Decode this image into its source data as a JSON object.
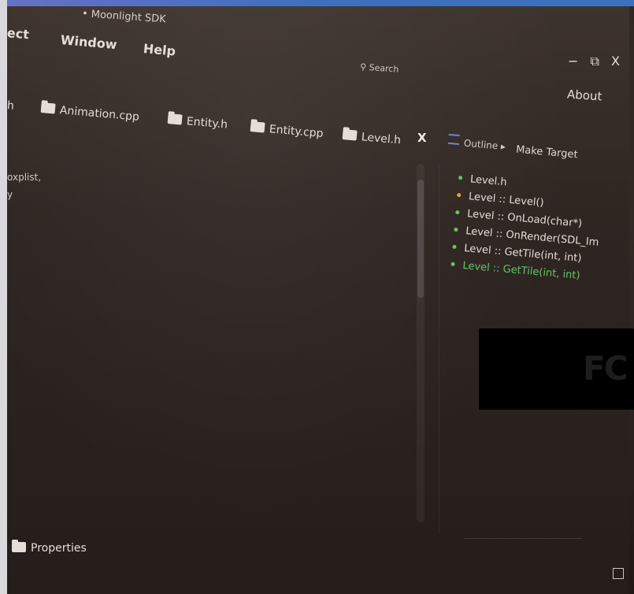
{
  "window": {
    "title": "• Moonlight SDK"
  },
  "menu": {
    "items": [
      {
        "label": "ect"
      },
      {
        "label": "Window"
      },
      {
        "label": "Help"
      }
    ]
  },
  "toolbar": {
    "search_label": "Search",
    "about_label": "About",
    "controls": {
      "minimize": "−",
      "restore": "⧉",
      "close": "X"
    }
  },
  "tabs": [
    {
      "label": "h"
    },
    {
      "label": "Animation.cpp"
    },
    {
      "label": "Entity.h"
    },
    {
      "label": "Entity.cpp"
    },
    {
      "label": "Level.h"
    }
  ],
  "tab_close": "X",
  "editor": {
    "snippets": [
      "oxplist,",
      "y"
    ]
  },
  "outline": {
    "header": "Outline ▸",
    "make_target": "Make Target",
    "items": [
      {
        "label": "Level.h",
        "bullet_color": "#62c763"
      },
      {
        "label": "Level :: Level()",
        "bullet_color": "#e3a23a"
      },
      {
        "label": "Level :: OnLoad(char*)",
        "bullet_color": "#62c763"
      },
      {
        "label": "Level :: OnRender(SDL_Im",
        "bullet_color": "#62c763"
      },
      {
        "label": "Level :: GetTile(int, int)",
        "bullet_color": "#62c763"
      },
      {
        "label": "Level :: GetTile(int, int)",
        "bullet_color": "#62c763",
        "active": true
      }
    ]
  },
  "bottom_panel": {
    "label": "Properties"
  },
  "overlay": {
    "text": "FC"
  },
  "colors": {
    "accent_green": "#62c763",
    "accent_orange": "#e3a23a",
    "top_gradient": [
      "#6770c6",
      "#3a72c0"
    ]
  }
}
